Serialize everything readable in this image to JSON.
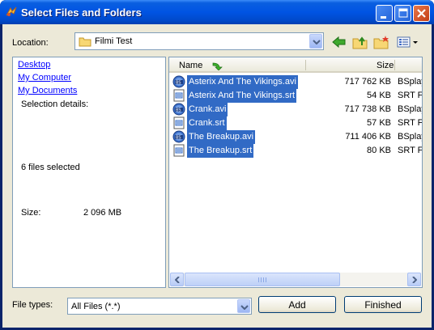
{
  "window": {
    "title": "Select Files and Folders"
  },
  "location": {
    "label": "Location:",
    "value": "Filmi Test"
  },
  "left_pane": {
    "links": [
      "Desktop",
      "My Computer",
      "My Documents"
    ],
    "selection_details_label": "Selection details:",
    "selected_count_text": "6 files selected",
    "size_label": "Size:",
    "size_value": "2 096 MB"
  },
  "file_list": {
    "columns": {
      "name": "Name",
      "size": "Size"
    },
    "rows": [
      {
        "name": "Asterix And The Vikings.avi",
        "size": "717 762 KB",
        "type": "BSplay",
        "icon": "bsplayer-icon"
      },
      {
        "name": "Asterix And The Vikings.srt",
        "size": "54 KB",
        "type": "SRT F",
        "icon": "subtitle-file-icon"
      },
      {
        "name": "Crank.avi",
        "size": "717 738 KB",
        "type": "BSplay",
        "icon": "bsplayer-icon"
      },
      {
        "name": "Crank.srt",
        "size": "57 KB",
        "type": "SRT F",
        "icon": "subtitle-file-icon"
      },
      {
        "name": "The Breakup.avi",
        "size": "711 406 KB",
        "type": "BSplay",
        "icon": "bsplayer-icon"
      },
      {
        "name": "The Breakup.srt",
        "size": "80 KB",
        "type": "SRT F",
        "icon": "subtitle-file-icon"
      }
    ]
  },
  "file_types": {
    "label": "File types:",
    "value": "All Files (*.*)"
  },
  "buttons": {
    "add": "Add",
    "finished": "Finished"
  },
  "colors": {
    "selection": "#316ac5",
    "title_bar": "#0054e3",
    "client_bg": "#ece9d8",
    "link": "#0000ff"
  }
}
